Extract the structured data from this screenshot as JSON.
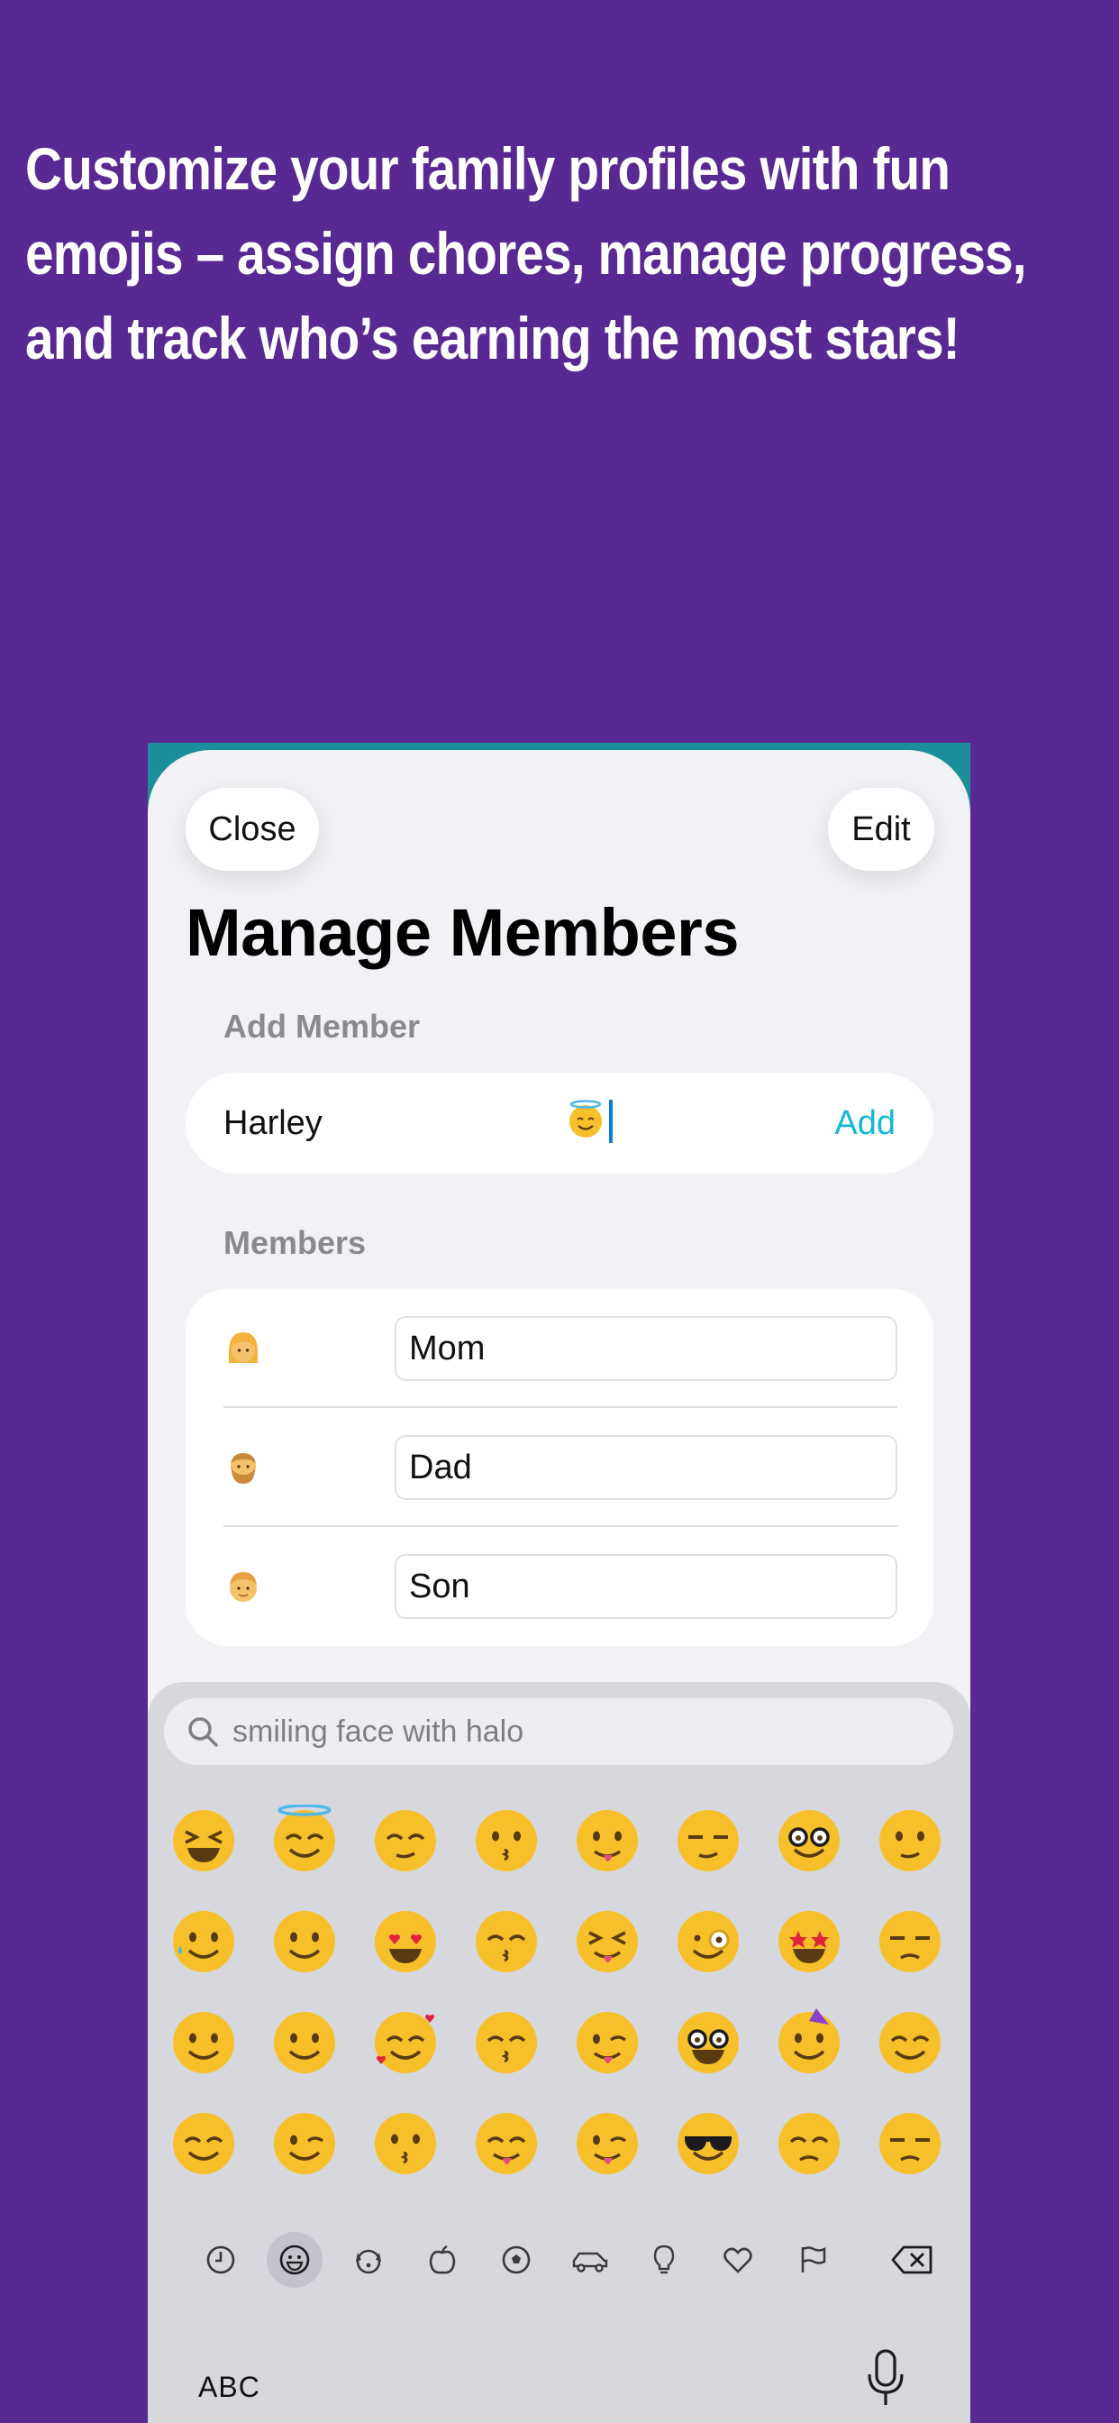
{
  "headline": {
    "line1": "Customize your family profiles with fun",
    "line2": "emojis – assign chores, manage progress,",
    "line3": "and track who’s earning the most stars!"
  },
  "sheet": {
    "close_label": "Close",
    "edit_label": "Edit",
    "title": "Manage Members",
    "add_member_label": "Add Member",
    "members_label": "Members"
  },
  "add_member": {
    "name_value": "Harley",
    "selected_emoji": "smiling-face-with-halo",
    "add_label": "Add"
  },
  "members": [
    {
      "emoji": "woman-blond",
      "name": "Mom"
    },
    {
      "emoji": "man-beard",
      "name": "Dad"
    },
    {
      "emoji": "boy",
      "name": "Son"
    }
  ],
  "keyboard": {
    "search_text": "smiling face with halo",
    "abc_label": "ABC",
    "emoji_rows": [
      [
        "rolling-on-floor-laughing",
        "smiling-face-with-halo",
        "relieved-face",
        "kissing-face",
        "face-with-tongue",
        "face-with-raised-eyebrow",
        "disguised-face",
        "smirking-face"
      ],
      [
        "smiling-face-with-tear",
        "slightly-smiling-face",
        "heart-eyes",
        "kissing-smiling-eyes",
        "squinting-tongue",
        "face-with-monocle",
        "star-struck",
        "unamused-face"
      ],
      [
        "smiling-face",
        "upside-down-face",
        "smiling-face-with-hearts",
        "kissing-closed-eyes",
        "winking-tongue",
        "nerd-face",
        "partying-face",
        "face-exhaling"
      ],
      [
        "smiling-eyes",
        "winking-face",
        "face-blowing-kiss",
        "face-savoring-food",
        "zany-face",
        "sunglasses-face",
        "pensive-face",
        "disappointed-face"
      ]
    ],
    "categories": [
      "recent-icon",
      "smileys-icon",
      "animals-icon",
      "food-icon",
      "activity-icon",
      "travel-icon",
      "objects-icon",
      "symbols-icon",
      "flags-icon",
      "delete-icon"
    ],
    "active_category": "smileys-icon"
  },
  "colors": {
    "background": "#592993",
    "accent": "#14B8D6",
    "emoji_yellow": "#F7C02B"
  }
}
